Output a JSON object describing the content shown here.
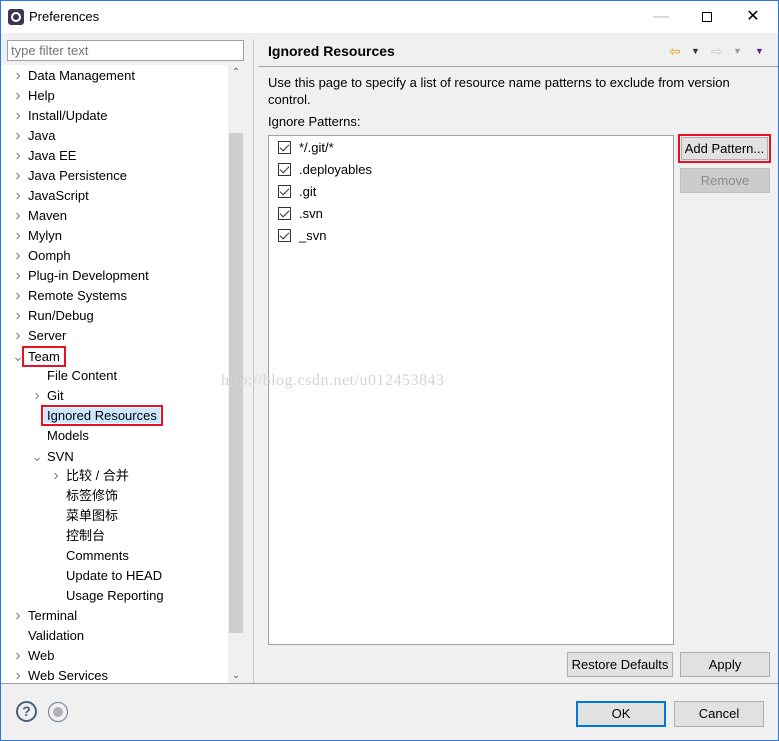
{
  "window": {
    "title": "Preferences",
    "minimize_icon": "minimize-icon",
    "maximize_icon": "maximize-icon",
    "close_icon": "close-icon"
  },
  "filter": {
    "placeholder": "type filter text",
    "value": ""
  },
  "tree": {
    "items": [
      {
        "label": "Data Management",
        "level": 0,
        "expander": "collapsed"
      },
      {
        "label": "Help",
        "level": 0,
        "expander": "collapsed"
      },
      {
        "label": "Install/Update",
        "level": 0,
        "expander": "collapsed"
      },
      {
        "label": "Java",
        "level": 0,
        "expander": "collapsed"
      },
      {
        "label": "Java EE",
        "level": 0,
        "expander": "collapsed"
      },
      {
        "label": "Java Persistence",
        "level": 0,
        "expander": "collapsed"
      },
      {
        "label": "JavaScript",
        "level": 0,
        "expander": "collapsed"
      },
      {
        "label": "Maven",
        "level": 0,
        "expander": "collapsed"
      },
      {
        "label": "Mylyn",
        "level": 0,
        "expander": "collapsed"
      },
      {
        "label": "Oomph",
        "level": 0,
        "expander": "collapsed"
      },
      {
        "label": "Plug-in Development",
        "level": 0,
        "expander": "collapsed"
      },
      {
        "label": "Remote Systems",
        "level": 0,
        "expander": "collapsed"
      },
      {
        "label": "Run/Debug",
        "level": 0,
        "expander": "collapsed"
      },
      {
        "label": "Server",
        "level": 0,
        "expander": "collapsed"
      },
      {
        "label": "Team",
        "level": 0,
        "expander": "expanded",
        "highlighted": true
      },
      {
        "label": "File Content",
        "level": 1,
        "expander": "none"
      },
      {
        "label": "Git",
        "level": 1,
        "expander": "collapsed"
      },
      {
        "label": "Ignored Resources",
        "level": 1,
        "expander": "none",
        "selected": true,
        "highlighted": true
      },
      {
        "label": "Models",
        "level": 1,
        "expander": "none"
      },
      {
        "label": "SVN",
        "level": 1,
        "expander": "expanded"
      },
      {
        "label": "比较 / 合并",
        "level": 2,
        "expander": "collapsed"
      },
      {
        "label": "标签修饰",
        "level": 2,
        "expander": "none"
      },
      {
        "label": "菜单图标",
        "level": 2,
        "expander": "none"
      },
      {
        "label": "控制台",
        "level": 2,
        "expander": "none"
      },
      {
        "label": "Comments",
        "level": 2,
        "expander": "none"
      },
      {
        "label": "Update to HEAD",
        "level": 2,
        "expander": "none"
      },
      {
        "label": "Usage Reporting",
        "level": 2,
        "expander": "none"
      },
      {
        "label": "Terminal",
        "level": 0,
        "expander": "collapsed"
      },
      {
        "label": "Validation",
        "level": 0,
        "expander": "none"
      },
      {
        "label": "Web",
        "level": 0,
        "expander": "collapsed"
      },
      {
        "label": "Web Services",
        "level": 0,
        "expander": "collapsed"
      }
    ]
  },
  "page": {
    "title": "Ignored Resources",
    "description": "Use this page to specify a list of resource name patterns to exclude from version control.",
    "patterns_label": "Ignore Patterns:",
    "patterns": [
      {
        "label": "*/.git/*",
        "checked": true
      },
      {
        "label": ".deployables",
        "checked": true
      },
      {
        "label": ".git",
        "checked": true
      },
      {
        "label": ".svn",
        "checked": true
      },
      {
        "label": "_svn",
        "checked": true
      }
    ],
    "add_pattern_label": "Add Pattern...",
    "remove_label": "Remove",
    "restore_defaults_label": "Restore Defaults",
    "apply_label": "Apply"
  },
  "footer": {
    "ok_label": "OK",
    "cancel_label": "Cancel",
    "help_glyph": "?"
  },
  "watermark": "http://blog.csdn.net/u012453843",
  "colors": {
    "highlight_box": "#e81123",
    "selection": "#cce8ff",
    "default_button_border": "#0078d7",
    "back_arrow": "#f5b93a",
    "menu_arrow": "#4b2a86"
  }
}
